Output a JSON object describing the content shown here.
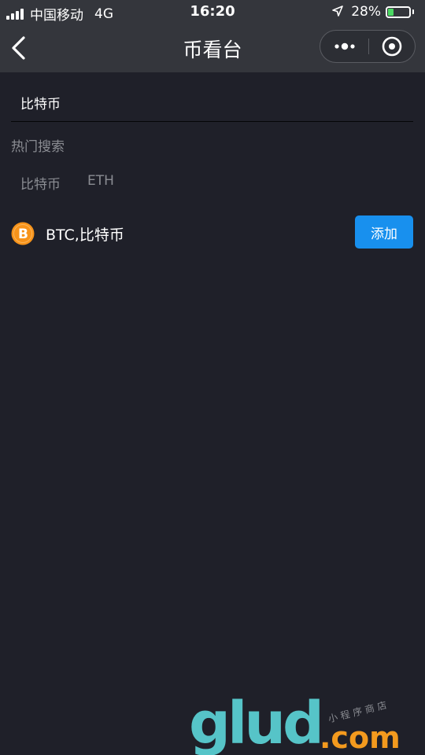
{
  "status_bar": {
    "carrier": "中国移动",
    "network": "4G",
    "time": "16:20",
    "battery_percent": "28%",
    "battery_level": 0.28
  },
  "nav": {
    "title": "币看台",
    "back_icon": "chevron-left-icon",
    "more_icon": "more-dots-icon",
    "close_icon": "target-circle-icon"
  },
  "search": {
    "value": "比特币"
  },
  "hot_search": {
    "title": "热门搜索",
    "tags": [
      "比特币",
      "ETH"
    ]
  },
  "results": [
    {
      "icon": "bitcoin-icon",
      "icon_glyph": "B",
      "name": "BTC,比特币",
      "action_label": "添加"
    }
  ],
  "colors": {
    "background": "#1f2029",
    "header": "#34363c",
    "accent": "#1890ee",
    "bitcoin": "#f7931a",
    "muted_text": "#8a8c92"
  },
  "watermark": {
    "brand": "glud",
    "domain": ".com",
    "tagline": "小程序商店"
  }
}
